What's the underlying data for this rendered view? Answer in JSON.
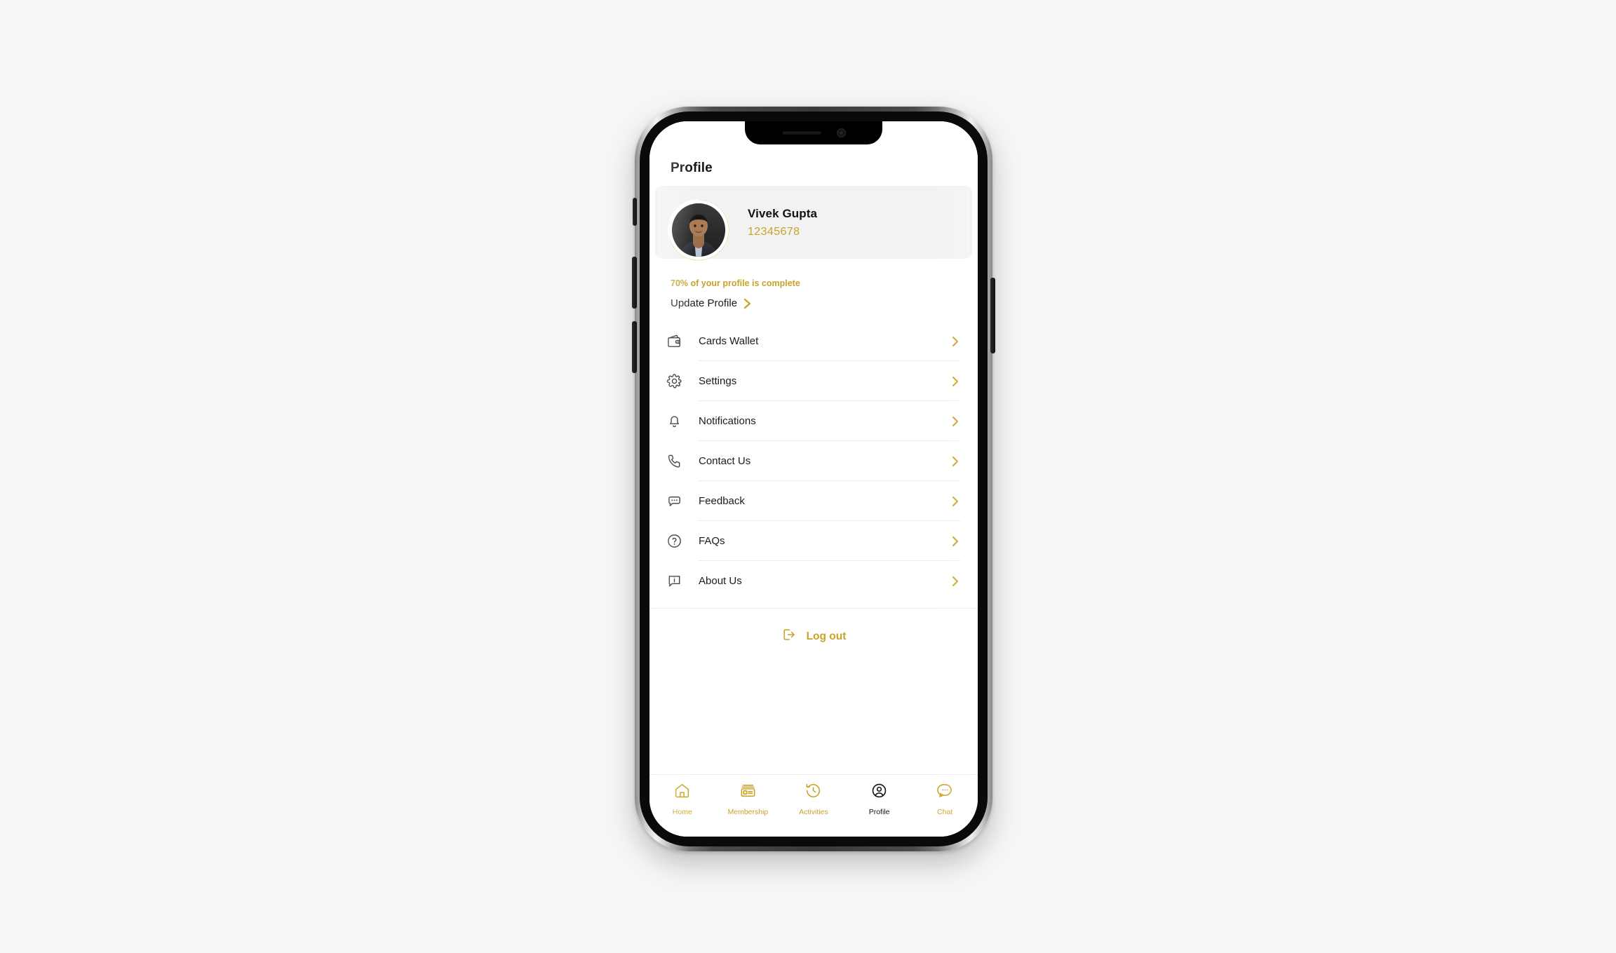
{
  "app": {
    "header": {
      "title": "Profile"
    },
    "profile": {
      "name": "Vivek Gupta",
      "member_id": "12345678",
      "avatar_icon": "user-photo",
      "ring_percent": 70
    },
    "completion": {
      "text": "70% of your profile is complete",
      "update_label": "Update Profile",
      "update_chevron_icon": "chevron-right-icon"
    },
    "menu": [
      {
        "label": "Cards Wallet",
        "icon": "wallet-icon",
        "chevron_icon": "chevron-right-icon"
      },
      {
        "label": "Settings",
        "icon": "gear-icon",
        "chevron_icon": "chevron-right-icon"
      },
      {
        "label": "Notifications",
        "icon": "bell-icon",
        "chevron_icon": "chevron-right-icon"
      },
      {
        "label": "Contact Us",
        "icon": "phone-icon",
        "chevron_icon": "chevron-right-icon"
      },
      {
        "label": "Feedback",
        "icon": "chat-dots-icon",
        "chevron_icon": "chevron-right-icon"
      },
      {
        "label": "FAQs",
        "icon": "question-mark-icon",
        "chevron_icon": "chevron-right-icon"
      },
      {
        "label": "About Us",
        "icon": "info-bubble-icon",
        "chevron_icon": "chevron-right-icon"
      }
    ],
    "logout": {
      "label": "Log out",
      "icon": "logout-icon"
    },
    "tabbar": [
      {
        "label": "Home",
        "icon": "home-icon",
        "active": false
      },
      {
        "label": "Membership",
        "icon": "id-card-icon",
        "active": false
      },
      {
        "label": "Activities",
        "icon": "clock-back-icon",
        "active": false
      },
      {
        "label": "Profile",
        "icon": "user-circle-icon",
        "active": true
      },
      {
        "label": "Chat",
        "icon": "chat-bubble-icon",
        "active": false
      }
    ]
  },
  "colors": {
    "gold": "#C9A227",
    "ink": "#1B1B1B",
    "card_bg": "#F2F2F2",
    "page_bg": "#F6F6F6",
    "divider": "#ECECEC"
  }
}
